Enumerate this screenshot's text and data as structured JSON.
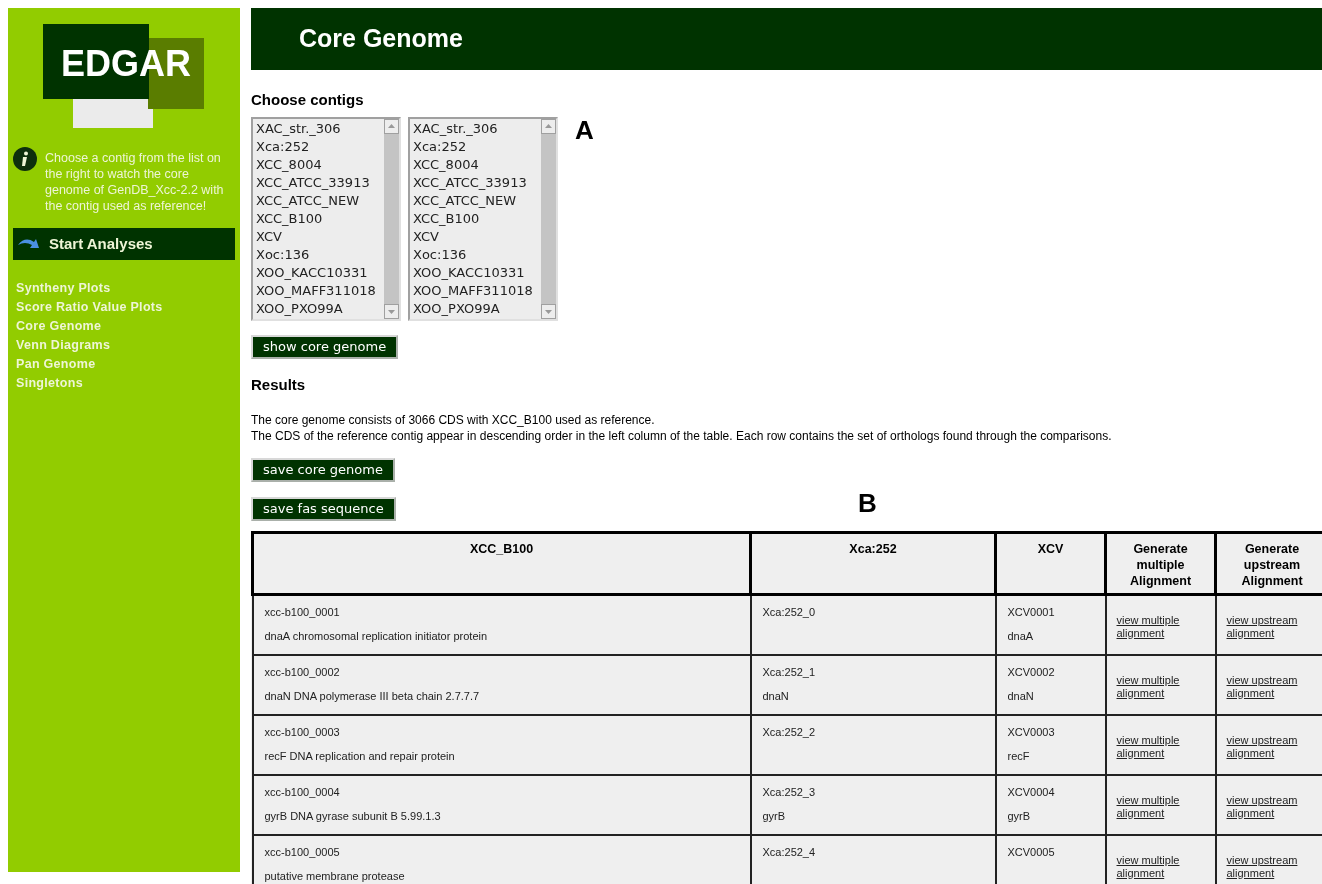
{
  "sidebar": {
    "logo": "EDGAR",
    "info": "Choose a contig from the list on the right to watch the core genome of GenDB_Xcc-2.2 with the contig used as reference!",
    "section_title": "Start Analyses",
    "nav": [
      "Syntheny Plots",
      "Score Ratio Value Plots",
      "Core Genome",
      "Venn Diagrams",
      "Pan Genome",
      "Singletons"
    ]
  },
  "header": {
    "title": "Core Genome"
  },
  "choose": {
    "label": "Choose contigs",
    "marker": "A",
    "lists": [
      {
        "items": [
          "XAC_str._306",
          "Xca:252",
          "XCC_8004",
          "XCC_ATCC_33913",
          "XCC_ATCC_NEW",
          "XCC_B100",
          "XCV",
          "Xoc:136",
          "XOO_KACC10331",
          "XOO_MAFF311018",
          "XOO_PXO99A"
        ]
      },
      {
        "items": [
          "XAC_str._306",
          "Xca:252",
          "XCC_8004",
          "XCC_ATCC_33913",
          "XCC_ATCC_NEW",
          "XCC_B100",
          "XCV",
          "Xoc:136",
          "XOO_KACC10331",
          "XOO_MAFF311018",
          "XOO_PXO99A"
        ]
      }
    ],
    "button": "show core genome"
  },
  "results": {
    "heading": "Results",
    "lines": [
      "The core genome consists of 3066 CDS with XCC_B100 used as reference.",
      "The CDS of the reference contig appear in descending order in the left column of the table. Each row contains the set of orthologs found through the comparisons."
    ],
    "buttons": [
      "save core genome",
      "save fas sequence"
    ],
    "marker": "B"
  },
  "table": {
    "columns": [
      "XCC_B100",
      "Xca:252",
      "XCV",
      "Generate multiple Alignment",
      "Generate upstream Alignment"
    ],
    "rows": [
      {
        "ref_id": "xcc-b100_0001",
        "ref_desc": "dnaA chromosomal replication initiator protein",
        "xca_id": "Xca:252_0",
        "xcv_id": "XCV0001",
        "xcv_gene": "dnaA",
        "multiple_link": "view multiple alignment",
        "upstream_link": "view upstream alignment"
      },
      {
        "ref_id": "xcc-b100_0002",
        "ref_desc": "dnaN DNA polymerase III beta chain 2.7.7.7",
        "xca_id": "Xca:252_1",
        "xca_gene": "dnaN",
        "xcv_id": "XCV0002",
        "xcv_gene": "dnaN",
        "multiple_link": "view multiple alignment",
        "upstream_link": "view upstream alignment"
      },
      {
        "ref_id": "xcc-b100_0003",
        "ref_desc": "recF DNA replication and repair protein",
        "xca_id": "Xca:252_2",
        "xcv_id": "XCV0003",
        "xcv_gene": "recF",
        "multiple_link": "view multiple alignment",
        "upstream_link": "view upstream alignment"
      },
      {
        "ref_id": "xcc-b100_0004",
        "ref_desc": "gyrB DNA gyrase subunit B 5.99.1.3",
        "xca_id": "Xca:252_3",
        "xca_gene": "gyrB",
        "xcv_id": "XCV0004",
        "xcv_gene": "gyrB",
        "multiple_link": "view multiple alignment",
        "upstream_link": "view upstream alignment"
      },
      {
        "ref_id": "xcc-b100_0005",
        "ref_desc": "putative membrane protease",
        "xca_id": "Xca:252_4",
        "xcv_id": "XCV0005",
        "multiple_link": "view multiple alignment",
        "upstream_link": "view upstream alignment"
      }
    ]
  }
}
